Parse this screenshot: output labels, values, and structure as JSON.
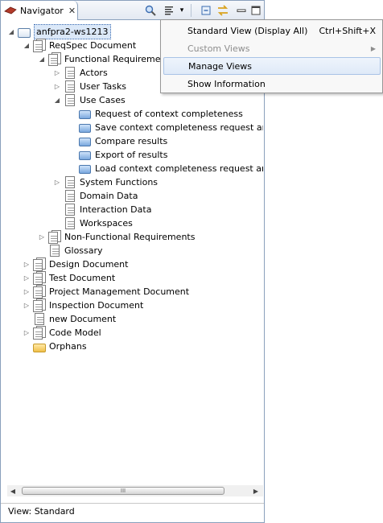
{
  "view": {
    "tab_title": "Navigator",
    "status": "View: Standard"
  },
  "toolbar": {
    "close_glyph": "✕",
    "search_icon": "🔍",
    "view_menu_glyph": "☰",
    "dropdown_glyph": "▾",
    "minimize_glyph": "▭",
    "maximize_glyph": "☐",
    "collapse_glyph": "⊟",
    "link_glyph": "⇆"
  },
  "scroll": {
    "thumb_grip": "III",
    "left": "◀",
    "right": "▶"
  },
  "tree": [
    {
      "label": "anfpra2-ws1213",
      "twisty": "◢",
      "icon": "project",
      "selected": true
    },
    {
      "label": "ReqSpec Document",
      "twisty": "◢",
      "icon": "docstack"
    },
    {
      "label": "Functional Requirements",
      "twisty": "◢",
      "icon": "docstack"
    },
    {
      "label": "Actors",
      "twisty": "▷",
      "icon": "doc"
    },
    {
      "label": "User Tasks",
      "twisty": "▷",
      "icon": "doc"
    },
    {
      "label": "Use Cases",
      "twisty": "◢",
      "icon": "doc"
    },
    {
      "label": "Request of context completeness",
      "twisty": "",
      "icon": "card"
    },
    {
      "label": "Save context completeness request and...",
      "twisty": "",
      "icon": "card"
    },
    {
      "label": "Compare results",
      "twisty": "",
      "icon": "card"
    },
    {
      "label": "Export of results",
      "twisty": "",
      "icon": "card"
    },
    {
      "label": "Load context completeness request and...",
      "twisty": "",
      "icon": "card"
    },
    {
      "label": "System Functions",
      "twisty": "▷",
      "icon": "doc"
    },
    {
      "label": "Domain Data",
      "twisty": "",
      "icon": "doc"
    },
    {
      "label": "Interaction Data",
      "twisty": "",
      "icon": "doc"
    },
    {
      "label": "Workspaces",
      "twisty": "",
      "icon": "doc"
    },
    {
      "label": "Non-Functional Requirements",
      "twisty": "▷",
      "icon": "docstack"
    },
    {
      "label": "Glossary",
      "twisty": "",
      "icon": "doc"
    },
    {
      "label": "Design Document",
      "twisty": "▷",
      "icon": "docstack"
    },
    {
      "label": "Test Document",
      "twisty": "▷",
      "icon": "docstack"
    },
    {
      "label": "Project Management Document",
      "twisty": "▷",
      "icon": "docstack"
    },
    {
      "label": "Inspection Document",
      "twisty": "▷",
      "icon": "docstack"
    },
    {
      "label": "new Document",
      "twisty": "",
      "icon": "doc"
    },
    {
      "label": "Code Model",
      "twisty": "▷",
      "icon": "docstack"
    },
    {
      "label": "Orphans",
      "twisty": "",
      "icon": "folder"
    }
  ],
  "menu": {
    "items": [
      {
        "label": "Standard View (Display All)",
        "accel": "Ctrl+Shift+X"
      },
      {
        "label": "Custom Views",
        "submenu": "▶",
        "disabled": true
      },
      {
        "label": "Manage Views"
      },
      {
        "label": "Show Information"
      }
    ]
  }
}
